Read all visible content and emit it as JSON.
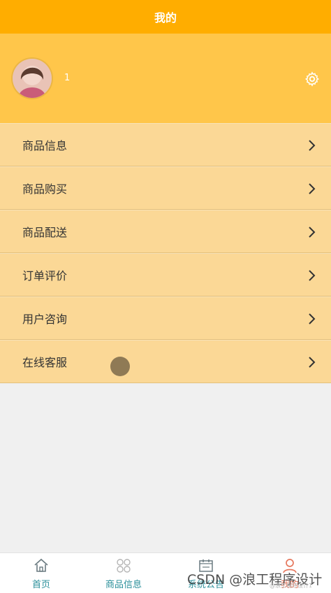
{
  "header": {
    "title": "我的"
  },
  "profile": {
    "username": "1"
  },
  "menu": [
    {
      "label": "商品信息"
    },
    {
      "label": "商品购买"
    },
    {
      "label": "商品配送"
    },
    {
      "label": "订单评价"
    },
    {
      "label": "用户咨询"
    },
    {
      "label": "在线客服"
    }
  ],
  "tabs": [
    {
      "label": "首页",
      "icon": "home-icon"
    },
    {
      "label": "商品信息",
      "icon": "grid-icon"
    },
    {
      "label": "系统公告",
      "icon": "calendar-icon"
    },
    {
      "label": "我的",
      "icon": "user-icon"
    }
  ],
  "watermark": {
    "text": "CSDN @浪工程序设计",
    "subtext": "@浪工程序设计1"
  },
  "colors": {
    "header": "#ffad00",
    "profile": "#ffc64a",
    "item": "#fbd896",
    "active_tab": "#e6785e",
    "tab": "#2a8f9a"
  }
}
